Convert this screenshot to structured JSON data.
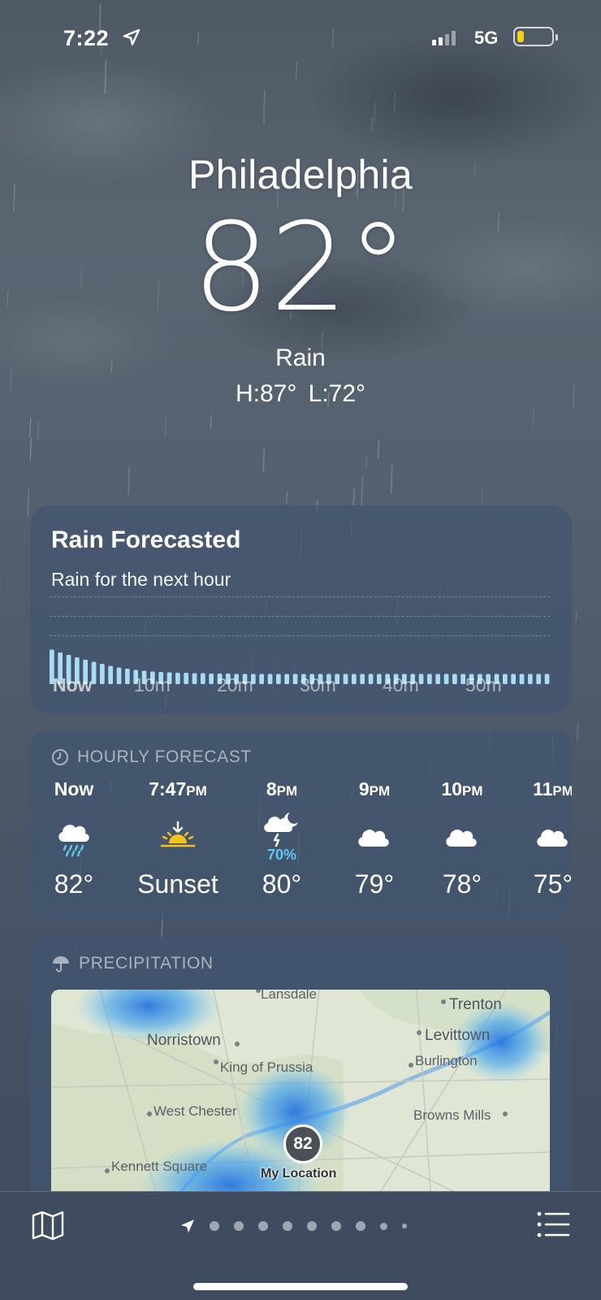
{
  "status_bar": {
    "time": "7:22",
    "network": "5G",
    "battery_level": 0.2,
    "battery_color": "#f7d20f"
  },
  "header": {
    "city": "Philadelphia",
    "temperature": "82°",
    "condition": "Rain",
    "high_low": "H:87°  L:72°"
  },
  "rain_forecast": {
    "title": "Rain Forecasted",
    "subtitle": "Rain for the next hour",
    "axis_labels": [
      "Now",
      "10m",
      "20m",
      "30m",
      "40m",
      "50m"
    ],
    "intensity": [
      0.85,
      0.78,
      0.72,
      0.66,
      0.6,
      0.55,
      0.5,
      0.45,
      0.41,
      0.38,
      0.35,
      0.33,
      0.31,
      0.3,
      0.29,
      0.28,
      0.28,
      0.27,
      0.27,
      0.26,
      0.26,
      0.26,
      0.25,
      0.25,
      0.25,
      0.25,
      0.25,
      0.25,
      0.25,
      0.25,
      0.25,
      0.25,
      0.25,
      0.25,
      0.25,
      0.25,
      0.25,
      0.25,
      0.25,
      0.25,
      0.25,
      0.25,
      0.25,
      0.25,
      0.25,
      0.25,
      0.25,
      0.25,
      0.25,
      0.25,
      0.25,
      0.25,
      0.25,
      0.25,
      0.25,
      0.25,
      0.25,
      0.25,
      0.25,
      0.25
    ],
    "bar_color": "#a8dcf5"
  },
  "hourly": {
    "heading": "HOURLY FORECAST",
    "items": [
      {
        "time": "Now",
        "suffix": "",
        "icon": "cloud-rain-icon",
        "pop": "",
        "temp": "82°"
      },
      {
        "time": "7:47",
        "suffix": "PM",
        "icon": "sunset-icon",
        "pop": "",
        "temp": "Sunset"
      },
      {
        "time": "8",
        "suffix": "PM",
        "icon": "cloud-moon-bolt-icon",
        "pop": "70%",
        "temp": "80°"
      },
      {
        "time": "9",
        "suffix": "PM",
        "icon": "cloud-icon",
        "pop": "",
        "temp": "79°"
      },
      {
        "time": "10",
        "suffix": "PM",
        "icon": "cloud-icon",
        "pop": "",
        "temp": "78°"
      },
      {
        "time": "11",
        "suffix": "PM",
        "icon": "cloud-icon",
        "pop": "",
        "temp": "75°"
      }
    ]
  },
  "precipitation": {
    "heading": "PRECIPITATION",
    "map_labels": [
      "Lansdale",
      "Trenton",
      "Norristown",
      "Levittown",
      "King of Prussia",
      "Burlington",
      "West Chester",
      "Browns Mills",
      "Kennett Square"
    ],
    "pin_temp": "82",
    "pin_label": "My Location"
  },
  "toolbar": {
    "map_icon": "map-icon",
    "list_icon": "list-icon",
    "page_count": 9,
    "current_page": 0
  }
}
